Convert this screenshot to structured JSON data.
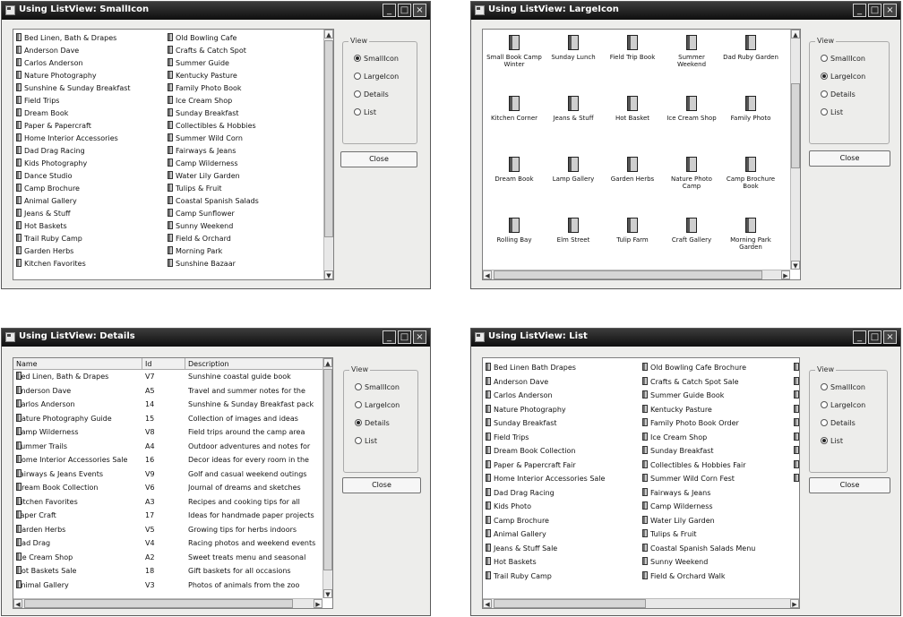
{
  "windows": {
    "small_icons": {
      "title": "Using ListView: SmallIcon",
      "col1": [
        "Bed Linen, Bath & Drapes",
        "Anderson Dave",
        "Carlos Anderson",
        "Nature Photography",
        "Sunshine & Sunday Breakfast",
        "Field Trips",
        "Dream Book",
        "Paper & Papercraft",
        "Home Interior Accessories",
        "Dad Drag Racing",
        "Kids Photography",
        "Dance Studio",
        "Camp Brochure",
        "Animal Gallery",
        "Jeans & Stuff",
        "Hot Baskets",
        "Trail Ruby Camp",
        "Garden Herbs",
        "Kitchen Favorites"
      ],
      "col2": [
        "Old Bowling Cafe",
        "Crafts & Catch Spot",
        "Summer Guide",
        "Kentucky Pasture",
        "Family Photo Book",
        "Ice Cream Shop",
        "Sunday Breakfast",
        "Collectibles & Hobbies",
        "Summer Wild Corn",
        "Fairways & Jeans",
        "Camp Wilderness",
        "Water Lily Garden",
        "Tulips & Fruit",
        "Coastal Spanish Salads",
        "Camp Sunflower",
        "Sunny Weekend",
        "Field & Orchard",
        "Morning Park",
        "Sunshine Bazaar"
      ],
      "group_label": "View",
      "options": [
        "SmallIcon",
        "LargeIcon",
        "Details",
        "List"
      ],
      "selected": 0,
      "button": "Close"
    },
    "large_icons": {
      "title": "Using ListView: LargeIcon",
      "items": [
        "Small Book Camp Winter",
        "Sunday Lunch",
        "Field Trip Book",
        "Summer Weekend",
        "Dad Ruby Garden",
        "Kitchen Corner",
        "Jeans & Stuff",
        "Hot Basket",
        "Ice Cream Shop",
        "Family Photo",
        "Dream Book",
        "Lamp Gallery",
        "Garden Herbs",
        "Nature Photo Camp",
        "Camp Brochure Book",
        "Rolling Bay",
        "Elm Street",
        "Tulip Farm",
        "Craft Gallery",
        "Morning Park Garden"
      ],
      "group_label": "View",
      "options": [
        "SmallIcon",
        "LargeIcon",
        "Details",
        "List"
      ],
      "selected": 1,
      "button": "Close"
    },
    "details": {
      "title": "Using ListView: Details",
      "headers": [
        "Name",
        "Id",
        "Description"
      ],
      "rows": [
        [
          "Bed Linen, Bath & Drapes",
          "V7",
          "Sunshine coastal guide book"
        ],
        [
          "Anderson Dave",
          "A5",
          "Travel and summer notes for the"
        ],
        [
          "Carlos Anderson",
          "14",
          "Sunshine & Sunday Breakfast pack"
        ],
        [
          "Nature Photography Guide",
          "15",
          "Collection of images and ideas"
        ],
        [
          "Camp Wilderness",
          "V8",
          "Field trips around the camp area"
        ],
        [
          "Summer Trails",
          "A4",
          "Outdoor adventures and notes for"
        ],
        [
          "Home Interior Accessories Sale",
          "16",
          "Decor ideas for every room in the"
        ],
        [
          "Fairways & Jeans Events",
          "V9",
          "Golf and casual weekend outings"
        ],
        [
          "Dream Book Collection",
          "V6",
          "Journal of dreams and sketches"
        ],
        [
          "Kitchen Favorites",
          "A3",
          "Recipes and cooking tips for all"
        ],
        [
          "Paper Craft",
          "17",
          "Ideas for handmade paper projects"
        ],
        [
          "Garden Herbs",
          "V5",
          "Growing tips for herbs indoors"
        ],
        [
          "Dad Drag",
          "V4",
          "Racing photos and weekend events"
        ],
        [
          "Ice Cream Shop",
          "A2",
          "Sweet treats menu and seasonal"
        ],
        [
          "Hot Baskets Sale",
          "18",
          "Gift baskets for all occasions"
        ],
        [
          "Animal Gallery",
          "V3",
          "Photos of animals from the zoo"
        ]
      ],
      "group_label": "View",
      "options": [
        "SmallIcon",
        "LargeIcon",
        "Details",
        "List"
      ],
      "selected": 2,
      "button": "Close"
    },
    "list": {
      "title": "Using ListView: List",
      "col1": [
        "Bed Linen Bath Drapes",
        "Anderson Dave",
        "Carlos Anderson",
        "Nature Photography",
        "Sunday Breakfast",
        "Field Trips",
        "Dream Book Collection",
        "Paper & Papercraft Fair",
        "Home Interior Accessories Sale",
        "Dad Drag Racing",
        "Kids Photo",
        "Camp Brochure",
        "Animal Gallery",
        "Jeans & Stuff Sale",
        "Hot Baskets",
        "Trail Ruby Camp"
      ],
      "col2": [
        "Old Bowling Cafe Brochure",
        "Crafts & Catch Spot Sale",
        "Summer Guide Book",
        "Kentucky Pasture",
        "Family Photo Book Order",
        "Ice Cream Shop",
        "Sunday Breakfast",
        "Collectibles & Hobbies Fair",
        "Summer Wild Corn Fest",
        "Fairways & Jeans",
        "Camp Wilderness",
        "Water Lily Garden",
        "Tulips & Fruit",
        "Coastal Spanish Salads Menu",
        "Sunny Weekend",
        "Field & Orchard Walk"
      ],
      "col3_count": 9,
      "group_label": "View",
      "options": [
        "SmallIcon",
        "LargeIcon",
        "Details",
        "List"
      ],
      "selected": 3,
      "button": "Close"
    }
  }
}
